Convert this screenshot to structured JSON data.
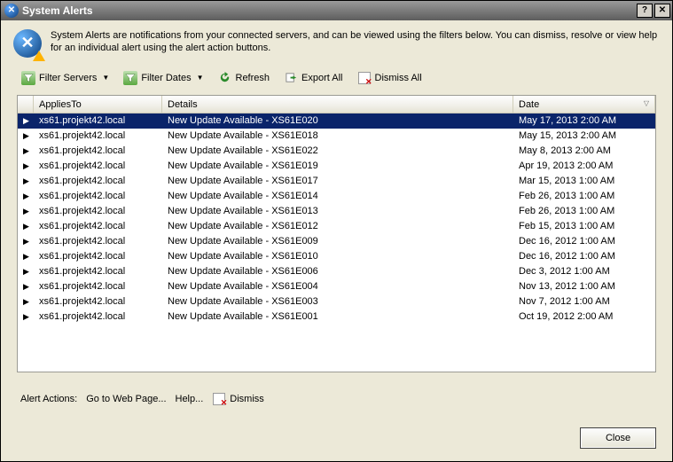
{
  "window": {
    "title": "System Alerts"
  },
  "info": {
    "text": "System Alerts are notifications from your connected servers, and can be viewed using the filters below. You can dismiss, resolve or view help for an individual alert using the alert action buttons."
  },
  "toolbar": {
    "filter_servers": "Filter Servers",
    "filter_dates": "Filter Dates",
    "refresh": "Refresh",
    "export_all": "Export All",
    "dismiss_all": "Dismiss All"
  },
  "columns": {
    "applies_to": "AppliesTo",
    "details": "Details",
    "date": "Date"
  },
  "rows": [
    {
      "selected": true,
      "applies": "xs61.projekt42.local",
      "details": "New Update Available - XS61E020",
      "date": "May 17, 2013 2:00 AM"
    },
    {
      "selected": false,
      "applies": "xs61.projekt42.local",
      "details": "New Update Available - XS61E018",
      "date": "May 15, 2013 2:00 AM"
    },
    {
      "selected": false,
      "applies": "xs61.projekt42.local",
      "details": "New Update Available - XS61E022",
      "date": "May 8, 2013 2:00 AM"
    },
    {
      "selected": false,
      "applies": "xs61.projekt42.local",
      "details": "New Update Available - XS61E019",
      "date": "Apr 19, 2013 2:00 AM"
    },
    {
      "selected": false,
      "applies": "xs61.projekt42.local",
      "details": "New Update Available - XS61E017",
      "date": "Mar 15, 2013 1:00 AM"
    },
    {
      "selected": false,
      "applies": "xs61.projekt42.local",
      "details": "New Update Available - XS61E014",
      "date": "Feb 26, 2013 1:00 AM"
    },
    {
      "selected": false,
      "applies": "xs61.projekt42.local",
      "details": "New Update Available - XS61E013",
      "date": "Feb 26, 2013 1:00 AM"
    },
    {
      "selected": false,
      "applies": "xs61.projekt42.local",
      "details": "New Update Available - XS61E012",
      "date": "Feb 15, 2013 1:00 AM"
    },
    {
      "selected": false,
      "applies": "xs61.projekt42.local",
      "details": "New Update Available - XS61E009",
      "date": "Dec 16, 2012 1:00 AM"
    },
    {
      "selected": false,
      "applies": "xs61.projekt42.local",
      "details": "New Update Available - XS61E010",
      "date": "Dec 16, 2012 1:00 AM"
    },
    {
      "selected": false,
      "applies": "xs61.projekt42.local",
      "details": "New Update Available - XS61E006",
      "date": "Dec 3, 2012 1:00 AM"
    },
    {
      "selected": false,
      "applies": "xs61.projekt42.local",
      "details": "New Update Available - XS61E004",
      "date": "Nov 13, 2012 1:00 AM"
    },
    {
      "selected": false,
      "applies": "xs61.projekt42.local",
      "details": "New Update Available - XS61E003",
      "date": "Nov 7, 2012 1:00 AM"
    },
    {
      "selected": false,
      "applies": "xs61.projekt42.local",
      "details": "New Update Available - XS61E001",
      "date": "Oct 19, 2012 2:00 AM"
    }
  ],
  "actions": {
    "label": "Alert Actions:",
    "go_to_web": "Go to Web Page...",
    "help": "Help...",
    "dismiss": "Dismiss"
  },
  "buttons": {
    "close": "Close"
  }
}
